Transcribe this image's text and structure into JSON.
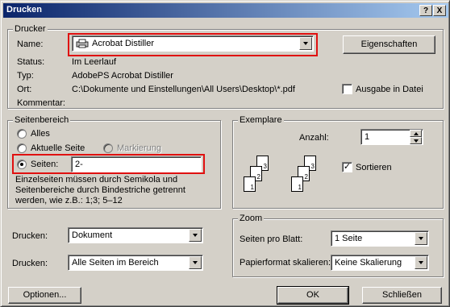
{
  "window": {
    "title": "Drucken",
    "help_btn": "?",
    "close_btn": "X"
  },
  "printer": {
    "group_label": "Drucker",
    "name_label": "Name:",
    "name_value": "Acrobat Distiller",
    "properties_button": "Eigenschaften",
    "status_label": "Status:",
    "status_value": "Im Leerlauf",
    "type_label": "Typ:",
    "type_value": "AdobePS Acrobat Distiller",
    "location_label": "Ort:",
    "location_value": "C:\\Dokumente und Einstellungen\\All Users\\Desktop\\*.pdf",
    "comment_label": "Kommentar:",
    "print_to_file_label": "Ausgabe in Datei",
    "print_to_file_checked": false
  },
  "page_range": {
    "group_label": "Seitenbereich",
    "all_label": "Alles",
    "current_label": "Aktuelle Seite",
    "selection_label": "Markierung",
    "pages_label": "Seiten:",
    "pages_value": "2-",
    "selected": "pages",
    "help_line1": "Einzelseiten müssen durch Semikola und",
    "help_line2": "Seitenbereiche durch Bindestriche getrennt",
    "help_line3": "werden, wie z.B.: 1;3; 5–12"
  },
  "copies": {
    "group_label": "Exemplare",
    "count_label": "Anzahl:",
    "count_value": "1",
    "collate_label": "Sortieren",
    "collate_checked": true,
    "stack1": [
      "3",
      "2",
      "1"
    ],
    "stack2": [
      "3",
      "2",
      "1"
    ]
  },
  "print_what": {
    "label": "Drucken:",
    "value": "Dokument"
  },
  "print_range": {
    "label": "Drucken:",
    "value": "Alle Seiten im Bereich"
  },
  "zoom": {
    "group_label": "Zoom",
    "pages_per_sheet_label": "Seiten pro Blatt:",
    "pages_per_sheet_value": "1 Seite",
    "scale_label": "Papierformat skalieren:",
    "scale_value": "Keine Skalierung"
  },
  "buttons": {
    "options": "Optionen...",
    "ok": "OK",
    "close": "Schließen"
  },
  "colors": {
    "dialog_bg": "#d4d0c8",
    "title_start": "#0a246a",
    "title_end": "#a6caf0",
    "highlight": "#e01010"
  }
}
